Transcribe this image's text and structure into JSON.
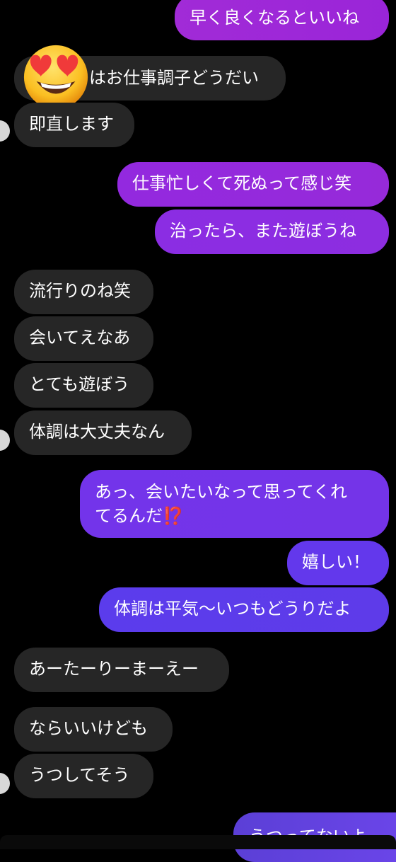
{
  "messages": [
    {
      "id": "m1",
      "dir": "out",
      "text": "早く良くなるといいね"
    },
    {
      "id": "m2",
      "dir": "in",
      "text": "はお仕事調子どうだい"
    },
    {
      "id": "m3",
      "dir": "in",
      "text": "即直します"
    },
    {
      "id": "m4",
      "dir": "out",
      "text": "仕事忙しくて死ぬって感じ笑"
    },
    {
      "id": "m5",
      "dir": "out",
      "text": "治ったら、また遊ぼうね"
    },
    {
      "id": "m6",
      "dir": "in",
      "text": "流行りのね笑"
    },
    {
      "id": "m7",
      "dir": "in",
      "text": "会いてえなあ"
    },
    {
      "id": "m8",
      "dir": "in",
      "text": "とても遊ぼう"
    },
    {
      "id": "m9",
      "dir": "in",
      "text": "体調は大丈夫なん"
    },
    {
      "id": "m10",
      "dir": "out",
      "line1": "あっ、会いたいなって思ってくれ",
      "line2": "てるんだ",
      "emoji": "⁉️"
    },
    {
      "id": "m11",
      "dir": "out",
      "text": "嬉しい！"
    },
    {
      "id": "m12",
      "dir": "out",
      "text": "体調は平気〜いつもどうりだよ"
    },
    {
      "id": "m13",
      "dir": "in",
      "text": "あーたーりーまーえー"
    },
    {
      "id": "m14",
      "dir": "in",
      "text": "ならいいけども"
    },
    {
      "id": "m15",
      "dir": "in",
      "text": "うつしてそう"
    },
    {
      "id": "m16",
      "dir": "out",
      "text": "うつってないよ"
    }
  ],
  "reaction_emoji": "heart-eyes",
  "colors": {
    "incoming": "#262626",
    "outgoing_top": "#a521d8",
    "outgoing_mid": "#8a2ee6",
    "outgoing_bottom": "#5b3fd6",
    "background": "#000000"
  }
}
